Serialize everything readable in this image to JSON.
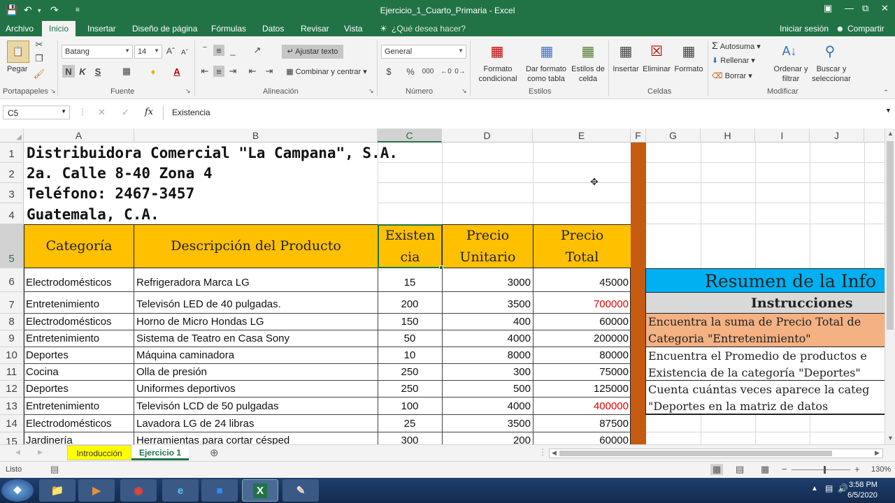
{
  "window": {
    "title": "Ejercicio_1_Cuarto_Primaria - Excel"
  },
  "ribbon_tabs": [
    {
      "label": "Archivo"
    },
    {
      "label": "Inicio"
    },
    {
      "label": "Insertar"
    },
    {
      "label": "Diseño de página"
    },
    {
      "label": "Fórmulas"
    },
    {
      "label": "Datos"
    },
    {
      "label": "Revisar"
    },
    {
      "label": "Vista"
    }
  ],
  "tell_me": "¿Qué desea hacer?",
  "account": {
    "signin": "Iniciar sesión",
    "share": "Compartir"
  },
  "ribbon": {
    "clipboard": {
      "paste": "Pegar",
      "group": "Portapapeles"
    },
    "font": {
      "name": "Batang",
      "size": "14",
      "bold": "N",
      "italic": "K",
      "underline": "S",
      "group": "Fuente"
    },
    "alignment": {
      "wrap": "Ajustar texto",
      "merge": "Combinar y centrar",
      "group": "Alineación"
    },
    "number": {
      "format": "General",
      "currency": "$",
      "percent": "%",
      "thousands": "000",
      "group": "Número"
    },
    "styles": {
      "conditional": "Formato condicional",
      "table": "Dar formato como tabla",
      "cell_styles": "Estilos de celda",
      "group": "Estilos"
    },
    "cells": {
      "insert": "Insertar",
      "delete": "Eliminar",
      "format": "Formato",
      "group": "Celdas"
    },
    "editing": {
      "autosum": "Autosuma",
      "fill": "Rellenar",
      "clear": "Borrar",
      "sort": "Ordenar y filtrar",
      "find": "Buscar y seleccionar",
      "group": "Modificar"
    }
  },
  "formula_bar": {
    "name_box": "C5",
    "fx": "fx",
    "content": "Existencia"
  },
  "columns": [
    "A",
    "B",
    "C",
    "D",
    "E",
    "F",
    "G",
    "H",
    "I",
    "J"
  ],
  "rows": [
    "1",
    "2",
    "3",
    "4",
    "5",
    "6",
    "7",
    "8",
    "9",
    "10",
    "11",
    "12",
    "13",
    "14",
    "15"
  ],
  "company": {
    "line1": "Distribuidora Comercial \"La Campana\", S.A.",
    "line2": "2a. Calle 8-40 Zona 4",
    "line3": "Teléfono: 2467-3457",
    "line4": "Guatemala, C.A."
  },
  "table_headers": {
    "categoria": "Categoría",
    "descripcion": "Descripción del Producto",
    "existencia_1": "Existen",
    "existencia_2": "cia",
    "precio_unitario_1": "Precio",
    "precio_unitario_2": "Unitario",
    "precio_total_1": "Precio",
    "precio_total_2": "Total"
  },
  "table_rows": [
    {
      "categoria": "Electrodomésticos",
      "descripcion": "Refrigeradora Marca LG",
      "existencia": "15",
      "precio_unitario": "3000",
      "precio_total": "45000",
      "highlight": false
    },
    {
      "categoria": "Entretenimiento",
      "descripcion": "Televisón LED de 40 pulgadas.",
      "existencia": "200",
      "precio_unitario": "3500",
      "precio_total": "700000",
      "highlight": true
    },
    {
      "categoria": "Electrodomésticos",
      "descripcion": "Horno de Micro Hondas LG",
      "existencia": "150",
      "precio_unitario": "400",
      "precio_total": "60000",
      "highlight": false
    },
    {
      "categoria": "Entretenimiento",
      "descripcion": "Sistema de Teatro en Casa Sony",
      "existencia": "50",
      "precio_unitario": "4000",
      "precio_total": "200000",
      "highlight": false
    },
    {
      "categoria": "Deportes",
      "descripcion": "Máquina caminadora",
      "existencia": "10",
      "precio_unitario": "8000",
      "precio_total": "80000",
      "highlight": false
    },
    {
      "categoria": "Cocina",
      "descripcion": "Olla de presión",
      "existencia": "250",
      "precio_unitario": "300",
      "precio_total": "75000",
      "highlight": false
    },
    {
      "categoria": "Deportes",
      "descripcion": "Uniformes deportivos",
      "existencia": "250",
      "precio_unitario": "500",
      "precio_total": "125000",
      "highlight": false
    },
    {
      "categoria": "Entretenimiento",
      "descripcion": "Televisón LCD de 50 pulgadas",
      "existencia": "100",
      "precio_unitario": "4000",
      "precio_total": "400000",
      "highlight": true
    },
    {
      "categoria": "Electrodomésticos",
      "descripcion": "Lavadora LG de 24 libras",
      "existencia": "25",
      "precio_unitario": "3500",
      "precio_total": "87500",
      "highlight": false
    },
    {
      "categoria": "Jardinería",
      "descripcion": "Herramientas para cortar césped",
      "existencia": "300",
      "precio_unitario": "200",
      "precio_total": "60000",
      "highlight": false
    }
  ],
  "summary": {
    "title": "Resumen de la Info",
    "instructions": "Instrucciones",
    "items": [
      {
        "line1": "Encuentra la suma de Precio Total de",
        "line2": "Categoria \"Entretenimiento\""
      },
      {
        "line1": "Encuentra el Promedio de productos e",
        "line2": "Existencia de la categoría \"Deportes\""
      },
      {
        "line1": "Cuenta cuántas veces aparece la categ",
        "line2": "\"Deportes en la matriz de datos"
      }
    ]
  },
  "sheets": [
    {
      "label": "Introducción",
      "active": false
    },
    {
      "label": "Ejercicio 1",
      "active": true
    }
  ],
  "status": {
    "ready": "Listo",
    "zoom": "130%"
  },
  "clock": {
    "time": "3:58 PM",
    "date": "6/5/2020"
  },
  "colors": {
    "excel_green": "#217346",
    "header_fill": "#ffc000",
    "summary_title": "#00b0f0",
    "instructions_fill": "#d9d9d9",
    "item1_fill": "#f4b183",
    "divider_col": "#c55a11"
  }
}
